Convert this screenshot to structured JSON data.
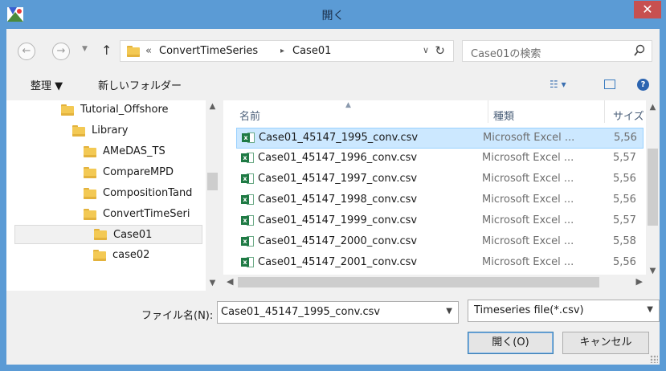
{
  "window": {
    "title": "開く",
    "close_glyph": "✕"
  },
  "nav": {
    "back_glyph": "←",
    "forward_glyph": "→",
    "dropdown_glyph": "▼",
    "up_glyph": "↑"
  },
  "address": {
    "chevron": "«",
    "crumbs": [
      "ConvertTimeSeries",
      "Case01"
    ],
    "separator": "▸",
    "dropdown_glyph": "∨",
    "refresh_glyph": "↻"
  },
  "search": {
    "placeholder": "Case01の検索"
  },
  "toolbar": {
    "organize_label": "整理 ▼",
    "new_folder_label": "新しいフォルダー",
    "view_glyph": "☷ ▾"
  },
  "tree": {
    "items": [
      {
        "label": "Tutorial_Offshore"
      },
      {
        "label": "Library"
      },
      {
        "label": "AMeDAS_TS"
      },
      {
        "label": "CompareMPD"
      },
      {
        "label": "CompositionTand"
      },
      {
        "label": "ConvertTimeSeri"
      },
      {
        "label": "Case01"
      },
      {
        "label": "case02"
      }
    ]
  },
  "file_list": {
    "columns": {
      "name": "名前",
      "type": "種類",
      "size": "サイズ"
    },
    "sort_glyph": "▲",
    "rows": [
      {
        "name": "Case01_45147_1995_conv.csv",
        "type": "Microsoft Excel ...",
        "size": "5,56"
      },
      {
        "name": "Case01_45147_1996_conv.csv",
        "type": "Microsoft Excel ...",
        "size": "5,57"
      },
      {
        "name": "Case01_45147_1997_conv.csv",
        "type": "Microsoft Excel ...",
        "size": "5,56"
      },
      {
        "name": "Case01_45147_1998_conv.csv",
        "type": "Microsoft Excel ...",
        "size": "5,56"
      },
      {
        "name": "Case01_45147_1999_conv.csv",
        "type": "Microsoft Excel ...",
        "size": "5,57"
      },
      {
        "name": "Case01_45147_2000_conv.csv",
        "type": "Microsoft Excel ...",
        "size": "5,58"
      },
      {
        "name": "Case01_45147_2001_conv.csv",
        "type": "Microsoft Excel ...",
        "size": "5,56"
      }
    ]
  },
  "footer": {
    "filename_label": "ファイル名(N):",
    "filename_value": "Case01_45147_1995_conv.csv",
    "filetype_value": "Timeseries file(*.csv)",
    "open_label": "開く(O)",
    "cancel_label": "キャンセル"
  },
  "colors": {
    "accent": "#5b9bd5",
    "selection": "#cce8ff",
    "close": "#c75050"
  }
}
